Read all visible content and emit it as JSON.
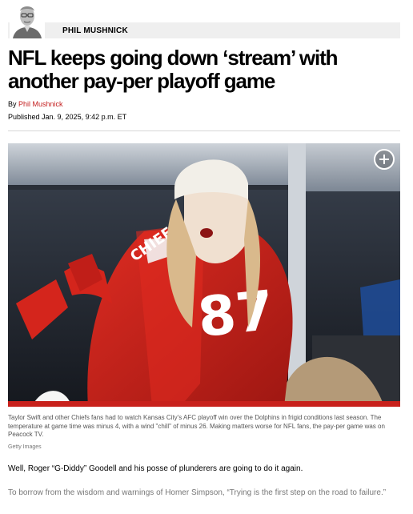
{
  "column": {
    "name": "PHIL MUSHNICK"
  },
  "article": {
    "headline": "NFL keeps going down ‘stream’ with another pay-per playoff game",
    "byline_prefix": "By",
    "author": "Phil Mushnick",
    "published": "Published Jan. 9, 2025, 9:42 p.m. ET"
  },
  "image": {
    "jersey_number": "87",
    "jersey_text": "CHIEFS",
    "caption": "Taylor Swift and other Chiefs fans had to watch Kansas City's AFC playoff win over the Dolphins in frigid conditions last season. The temperature at game time was minus 4, with a wind \"chill\" of minus 26. Making matters worse for NFL fans, the pay-per game was on Peacock TV.",
    "credit": "Getty Images"
  },
  "body": {
    "paragraph_1": "Well, Roger “G-Diddy” Goodell and his posse of plunderers are going to do it again.",
    "paragraph_2": "To borrow from the wisdom and warnings of Homer Simpson, “Trying is the first step on the road to failure.”"
  },
  "colors": {
    "link_red": "#c41e1e",
    "jersey_red": "#c8211c",
    "caption_gray": "#555555"
  },
  "icons": {
    "expand": "plus-circle-icon"
  }
}
